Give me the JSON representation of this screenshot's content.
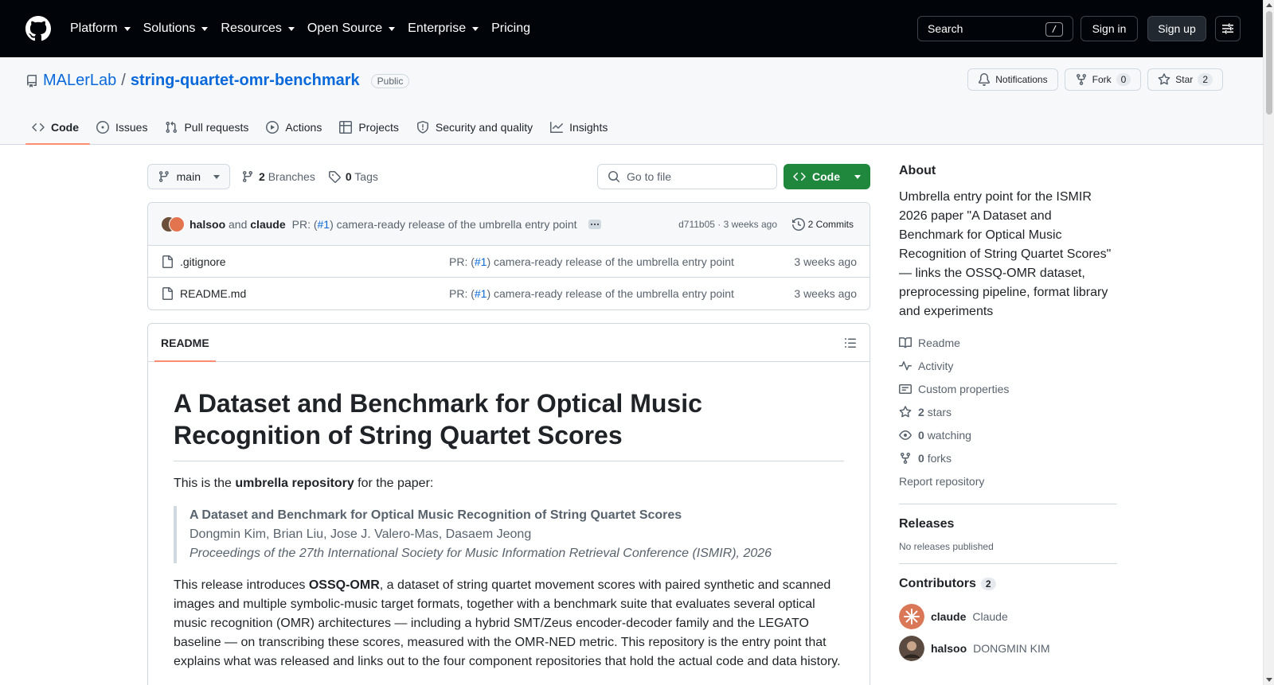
{
  "header": {
    "nav": [
      "Platform",
      "Solutions",
      "Resources",
      "Open Source",
      "Enterprise",
      "Pricing"
    ],
    "search_label": "Search",
    "search_shortcut": "/",
    "signin": "Sign in",
    "signup": "Sign up"
  },
  "repo": {
    "owner": "MALerLab",
    "separator": "/",
    "name": "string-quartet-omr-benchmark",
    "visibility": "Public",
    "notifications": "Notifications",
    "fork_label": "Fork",
    "fork_count": "0",
    "star_label": "Star",
    "star_count": "2"
  },
  "tabs": [
    "Code",
    "Issues",
    "Pull requests",
    "Actions",
    "Projects",
    "Security and quality",
    "Insights"
  ],
  "branch": {
    "current": "main",
    "branches_count": "2",
    "branches_label": "Branches",
    "tags_count": "0",
    "tags_label": "Tags",
    "goto_placeholder": "Go to file",
    "code_button": "Code"
  },
  "commit": {
    "author1": "halsoo",
    "and": "and",
    "author2": "claude",
    "msg_prefix": "PR: (",
    "msg_link": "#1",
    "msg_suffix": ") camera-ready release of the umbrella entry point",
    "sha_time": "d711b05 · 3 weeks ago",
    "commits": "2 Commits"
  },
  "files": [
    {
      "name": ".gitignore",
      "msg_prefix": "PR: (",
      "msg_link": "#1",
      "msg_suffix": ") camera-ready release of the umbrella entry point",
      "date": "3 weeks ago"
    },
    {
      "name": "README.md",
      "msg_prefix": "PR: (",
      "msg_link": "#1",
      "msg_suffix": ") camera-ready release of the umbrella entry point",
      "date": "3 weeks ago"
    }
  ],
  "readme": {
    "tab": "README",
    "title": "A Dataset and Benchmark for Optical Music Recognition of String Quartet Scores",
    "intro_pre": "This is the ",
    "intro_bold": "umbrella repository",
    "intro_post": " for the paper:",
    "quote_title": "A Dataset and Benchmark for Optical Music Recognition of String Quartet Scores",
    "quote_authors": "Dongmin Kim, Brian Liu, Jose J. Valero-Mas, Dasaem Jeong",
    "quote_venue": "Proceedings of the 27th International Society for Music Information Retrieval Conference (ISMIR), 2026",
    "para2_pre": "This release introduces ",
    "para2_bold": "OSSQ-OMR",
    "para2_post": ", a dataset of string quartet movement scores with paired synthetic and scanned images and multiple symbolic-music target formats, together with a benchmark suite that evaluates several optical music recognition (OMR) architectures — including a hybrid SMT/Zeus encoder-decoder family and the LEGATO baseline — on transcribing these scores, measured with the OMR-NED metric. This repository is the entry point that explains what was released and links out to the four component repositories that hold the actual code and data history."
  },
  "sidebar": {
    "about_title": "About",
    "about_desc": "Umbrella entry point for the ISMIR 2026 paper \"A Dataset and Benchmark for Optical Music Recognition of String Quartet Scores\" — links the OSSQ-OMR dataset, preprocessing pipeline, format library and experiments",
    "readme": "Readme",
    "activity": "Activity",
    "custom_props": "Custom properties",
    "stars_count": "2",
    "stars_label": "stars",
    "watching_count": "0",
    "watching_label": "watching",
    "forks_count": "0",
    "forks_label": "forks",
    "report": "Report repository",
    "releases_title": "Releases",
    "releases_none": "No releases published",
    "contributors_title": "Contributors",
    "contributors_count": "2",
    "contributors": [
      {
        "login": "claude",
        "name": "Claude"
      },
      {
        "login": "halsoo",
        "name": "DONGMIN KIM"
      }
    ]
  },
  "colors": {
    "header_bg": "#010409",
    "link": "#0969da",
    "green": "#1f883d",
    "tab_underline": "#fd8c73"
  }
}
